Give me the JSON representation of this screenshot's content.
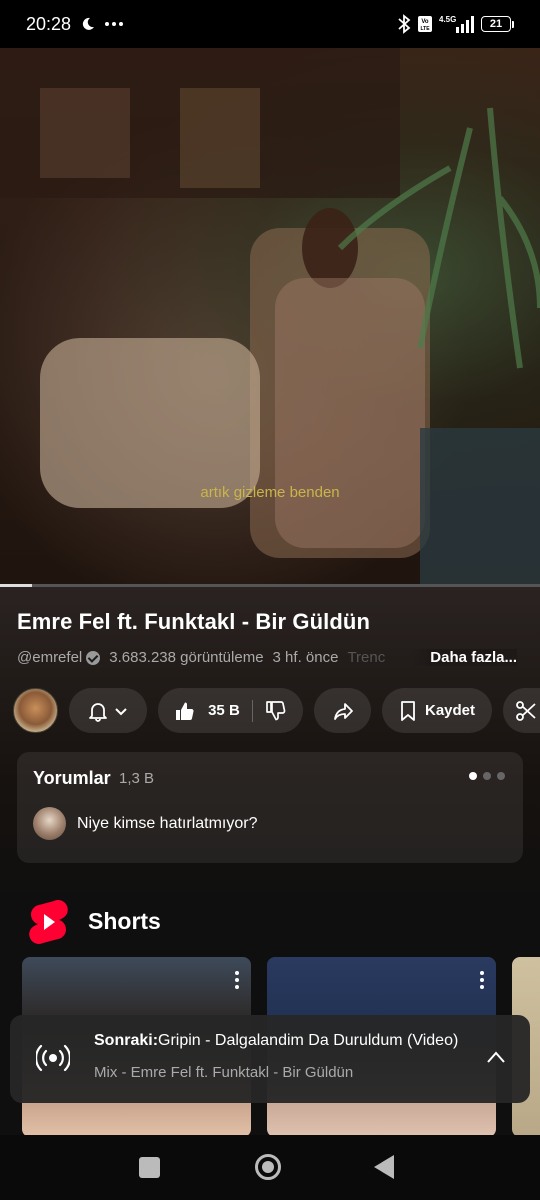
{
  "status_bar": {
    "time": "20:28",
    "left_icons": [
      "moon-icon",
      "more-dots-icon"
    ],
    "right_icons": [
      "bluetooth-icon",
      "volte-icon",
      "signal-4-5g-icon"
    ],
    "network": "4.5G",
    "battery": "21"
  },
  "video": {
    "subtitle": "artık gizleme benden",
    "progress": 0.06
  },
  "details": {
    "title": "Emre Fel ft. Funktakl - Bir Güldün",
    "channel": "@emrefel",
    "views": "3.683.238 görüntüleme",
    "age": "3 hf. önce",
    "trend_fragment": "Trenc",
    "more": "Daha fazla..."
  },
  "actions": {
    "likes": "35 B",
    "save": "Kaydet"
  },
  "comments": {
    "title": "Yorumlar",
    "count": "1,3 B",
    "top_comment": "Niye kimse hatırlatmıyor?",
    "pages": 3,
    "active_page": 0
  },
  "shorts": {
    "title": "Shorts"
  },
  "up_next": {
    "label": "Sonraki:",
    "title": "Gripin - Dalgalandim Da Duruldum (Video)",
    "subtitle": "Mix - Emre Fel ft. Funktakl - Bir Güldün"
  },
  "colors": {
    "background": "#0f0f0f",
    "shorts_red": "#ff0033",
    "subtitle_yellow": "#c9b54a"
  }
}
